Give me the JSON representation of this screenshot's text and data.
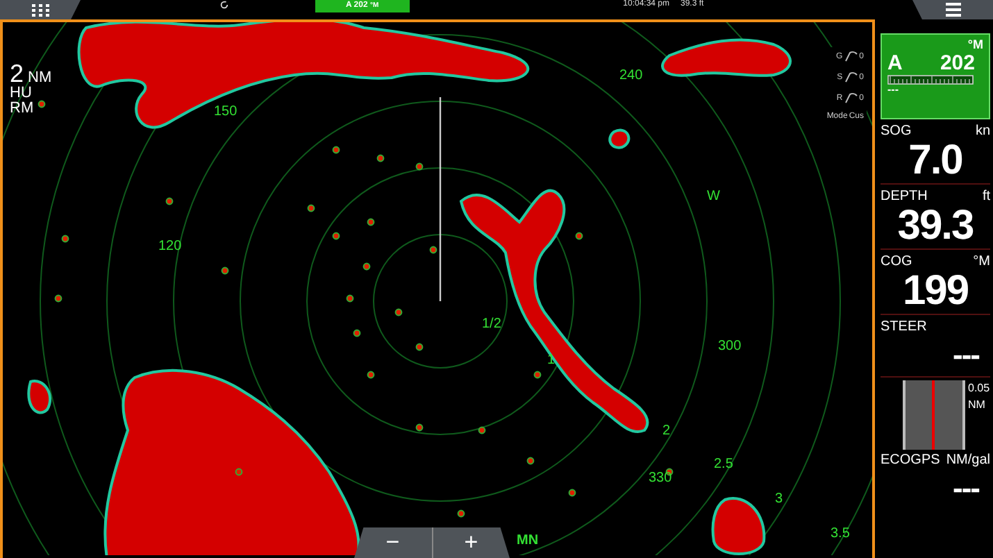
{
  "top_bar": {
    "heading_tab": "A 202",
    "heading_unit": "°M",
    "time": "10:04:34 pm",
    "depth": "39.3 ft"
  },
  "radar": {
    "range_value": "2",
    "range_unit": "NM",
    "orientation": "HU",
    "motion": "RM",
    "bearing_labels": [
      "150",
      "120",
      "240",
      "W",
      "300",
      "330"
    ],
    "range_labels": [
      "1/2",
      "1",
      "2",
      "2.5",
      "3",
      "3.5"
    ],
    "north_label": "MN",
    "gauges": [
      {
        "label": "G",
        "value": "0"
      },
      {
        "label": "S",
        "value": "0"
      },
      {
        "label": "R",
        "value": "0"
      }
    ],
    "mode": {
      "label": "Mode",
      "value": "Cus"
    },
    "zoom_buttons": [
      "−",
      "+"
    ]
  },
  "side_panel": {
    "autopilot": {
      "mode": "A",
      "heading": "202",
      "unit": "°M",
      "status": "---"
    },
    "readouts": [
      {
        "label": "SOG",
        "unit": "kn",
        "value": "7.0"
      },
      {
        "label": "DEPTH",
        "unit": "ft",
        "value": "39.3"
      },
      {
        "label": "COG",
        "unit": "°M",
        "value": "199"
      },
      {
        "label": "STEER",
        "value": "---"
      }
    ],
    "xte": {
      "scale": "0.05",
      "unit": "NM"
    },
    "eco": {
      "label": "ECOGPS",
      "unit": "NM/gal",
      "value": "---"
    }
  }
}
